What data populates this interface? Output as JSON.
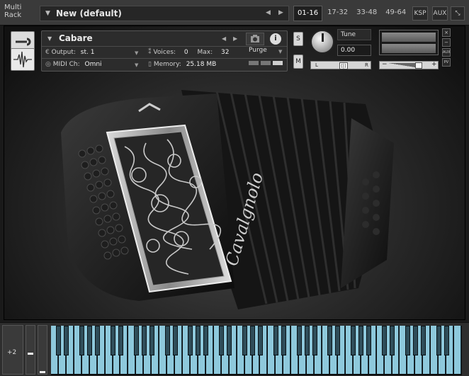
{
  "rack": {
    "label_line1": "Multi",
    "label_line2": "Rack",
    "preset_name": "New (default)",
    "tabs": [
      "01-16",
      "17-32",
      "33-48",
      "49-64"
    ],
    "active_tab": "01-16",
    "ksp_label": "KSP",
    "aux_label": "AUX"
  },
  "instrument": {
    "name": "Cabare",
    "output_label": "Output:",
    "output_value": "st. 1",
    "voices_label": "Voices:",
    "voices_value": "0",
    "max_label": "Max:",
    "max_value": "32",
    "purge_label": "Purge",
    "midi_label": "MIDI Ch:",
    "midi_value": "Omni",
    "memory_label": "Memory:",
    "memory_value": "25.18 MB",
    "info_label": "i",
    "solo_label": "S",
    "mute_label": "M",
    "tune_label": "Tune",
    "tune_value": "0.00",
    "pan_left": "L",
    "pan_right": "R",
    "vol_minus": "−",
    "vol_plus": "+",
    "close_label": "×",
    "min_label": "−",
    "aux_small": "AUX",
    "pv_small": "PV",
    "brand_text": "Cavalgnolo"
  },
  "keyboard": {
    "octave_value": "+2"
  },
  "colors": {
    "key_white": "#8ec9dc",
    "key_black": "#2f4d59",
    "background": "#1a1a1a"
  }
}
